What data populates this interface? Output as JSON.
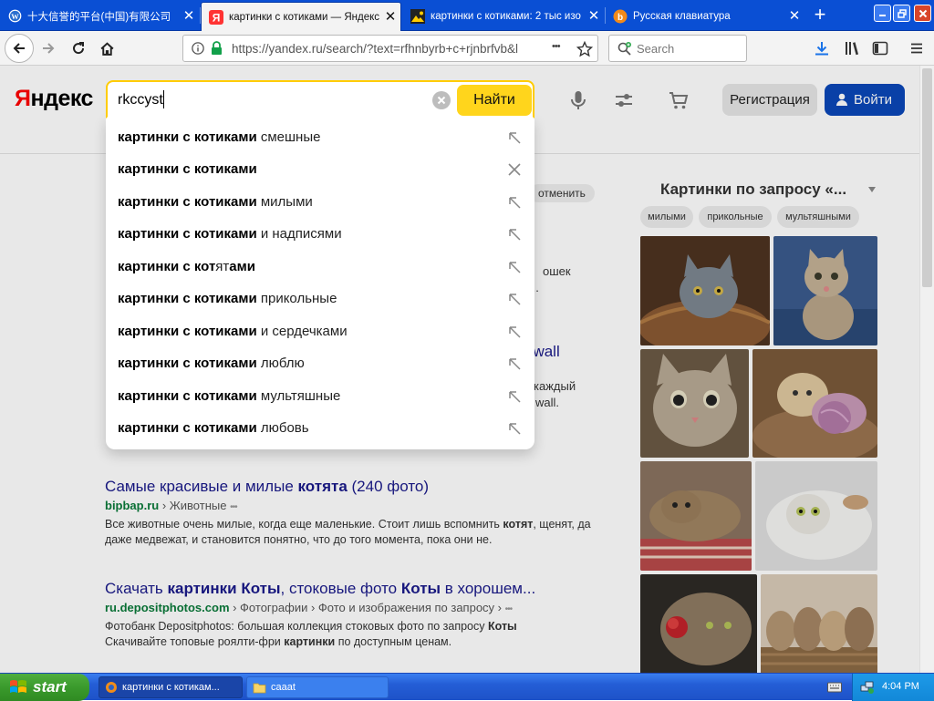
{
  "browser": {
    "tabs": [
      {
        "title": "十大信誉的平台(中国)有限公司",
        "icon": "wordpress-icon"
      },
      {
        "title": "картинки с котиками — Яндекс",
        "icon": "yandex-icon"
      },
      {
        "title": "картинки с котиками: 2 тыс изо",
        "icon": "image-icon"
      },
      {
        "title": "Русская клавиатура",
        "icon": "keyboard-site-icon"
      }
    ],
    "close_glyph": "✕",
    "newtab_glyph": "+",
    "url": "https://yandex.ru/search/?text=rfhnbyrb+c+rjnbrfvb&l",
    "search_placeholder": "Search",
    "page_actions_glyph": "•••"
  },
  "header": {
    "logo_first": "Я",
    "logo_rest": "ндекс",
    "query": "rkccyst",
    "find_label": "Найти",
    "register_label": "Регистрация",
    "login_label": "Войти"
  },
  "suggest": {
    "items": [
      {
        "bold": "картинки с котиками",
        "rest": " смешные",
        "action": "arrow"
      },
      {
        "bold": "картинки с котиками",
        "rest": "",
        "action": "remove"
      },
      {
        "bold": "картинки с котиками",
        "rest": " милыми",
        "action": "arrow"
      },
      {
        "bold": "картинки с котиками",
        "rest": " и надписями",
        "action": "arrow"
      },
      {
        "bold": "картинки с кот",
        "mid": "ят",
        "bold2": "ами",
        "action": "arrow"
      },
      {
        "bold": "картинки с котиками",
        "rest": " прикольные",
        "action": "arrow"
      },
      {
        "bold": "картинки с котиками",
        "rest": " и сердечками",
        "action": "arrow"
      },
      {
        "bold": "картинки с котиками",
        "rest": " люблю",
        "action": "arrow"
      },
      {
        "bold": "картинки с котиками",
        "rest": " мультяшные",
        "action": "arrow"
      },
      {
        "bold": "картинки с котиками",
        "rest": " любовь",
        "action": "arrow"
      }
    ]
  },
  "behind_fragments": {
    "cancel": "отменить",
    "frag1": "ошек",
    "frag2": "...",
    "frag3": "nwall",
    "frag4": "каждый",
    "frag5": "wall."
  },
  "results": [
    {
      "title_pre": "Самые красивые и милые ",
      "title_bold": "котята",
      "title_post": " (240 фото)",
      "domain": "bipbap.ru",
      "path": " › Животные",
      "desc_pre": "Все животные очень милые, когда еще маленькие. Стоит лишь вспомнить ",
      "desc_bold": "котят",
      "desc_post": ", щенят, да даже медвежат, и становится понятно, что до того момента, пока они не."
    },
    {
      "title_pre": "Скачать ",
      "title_bold": "картинки Коты",
      "title_mid": ", стоковые фото ",
      "title_bold2": "Коты",
      "title_post": " в хорошем...",
      "domain": "ru.depositphotos.com",
      "path": " › Фотографии › Фото и изображения по запросу ›",
      "desc_pre": "Фотобанк Depositphotos: большая коллекция стоковых фото по запросу ",
      "desc_bold": "Коты",
      "desc_line2_pre": "Скачивайте топовые роялти-фри ",
      "desc_line2_bold": "картинки",
      "desc_line2_post": " по доступным ценам."
    }
  ],
  "more_glyph": "•••",
  "images_panel": {
    "title": "Картинки по запросу «...",
    "tags": [
      "милыми",
      "прикольные",
      "мультяшными"
    ],
    "thumbs": [
      "cat-in-basket",
      "tabby-kitten-sitting",
      "gray-kitten-face",
      "kittens-with-yarn",
      "cat-lying",
      "white-kitten-lying",
      "cat-with-rose",
      "kittens-in-basket"
    ]
  },
  "taskbar": {
    "start_label": "start",
    "buttons": [
      "картинки с котикам...",
      "caaat"
    ],
    "time": "4:04 PM"
  },
  "colors": {
    "titlebar": "#0a4fd4",
    "accent_yellow": "#ffd51c",
    "link": "#1a1a8a",
    "url_green": "#0a7a3a",
    "login_blue": "#0a47b8"
  }
}
